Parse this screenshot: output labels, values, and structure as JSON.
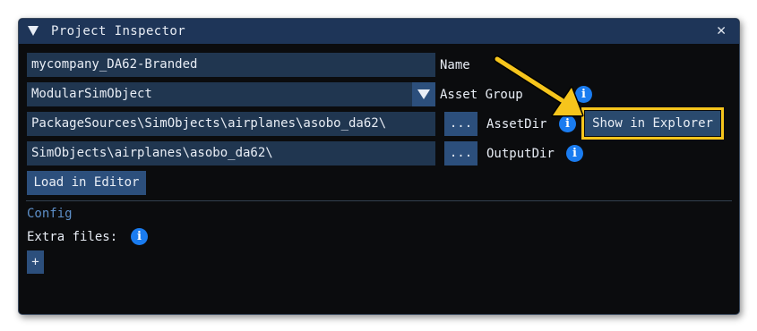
{
  "window": {
    "title": "Project Inspector"
  },
  "fields": {
    "name_value": "mycompany_DA62-Branded",
    "name_label": "Name",
    "asset_group_value": "ModularSimObject",
    "asset_group_label": "Asset Group",
    "asset_dir_value": "PackageSources\\SimObjects\\airplanes\\asobo_da62\\",
    "asset_dir_label": "AssetDir",
    "output_dir_value": "SimObjects\\airplanes\\asobo_da62\\",
    "output_dir_label": "OutputDir"
  },
  "buttons": {
    "browse_asset": "...",
    "browse_output": "...",
    "show_in_explorer": "Show in Explorer",
    "load_in_editor": "Load in Editor",
    "add": "+"
  },
  "config": {
    "header": "Config",
    "extra_files_label": "Extra files:"
  },
  "icons": {
    "info": "i",
    "close": "✕"
  },
  "colors": {
    "titlebar": "#1e3558",
    "field_bg": "#203650",
    "button_bg": "#2c4f7c",
    "info_blue": "#1a7cf0",
    "highlight_yellow": "#f6c51c",
    "section_header": "#5d8fc8"
  }
}
